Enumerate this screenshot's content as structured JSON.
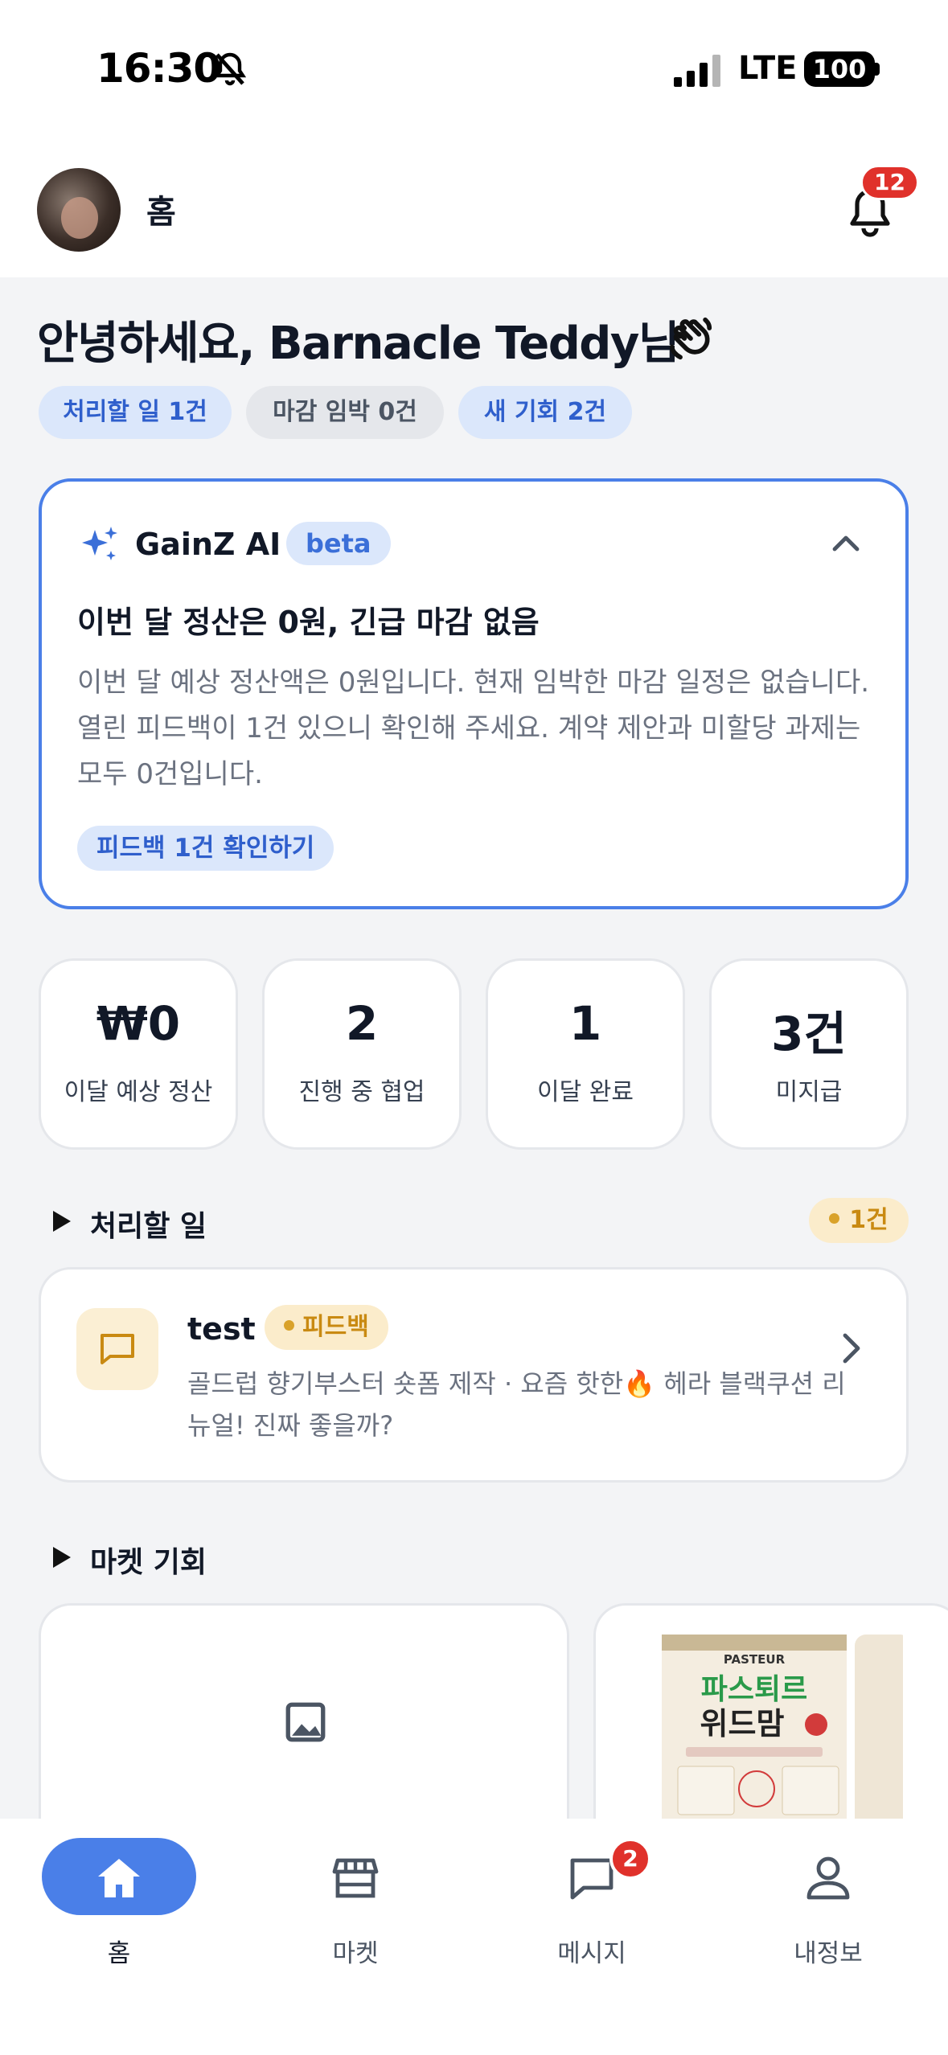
{
  "status_bar": {
    "time": "16:30",
    "network": "LTE",
    "battery": "100"
  },
  "header": {
    "title": "홈",
    "notification_count": "12"
  },
  "greeting": {
    "text": "안녕하세요, Barnacle Teddy님"
  },
  "chips": [
    {
      "label": "처리할 일 1건"
    },
    {
      "label": "마감 임박 0건"
    },
    {
      "label": "새 기회 2건"
    }
  ],
  "ai_card": {
    "title": "GainZ AI",
    "badge": "beta",
    "headline": "이번 달 정산은 0원, 긴급 마감 없음",
    "body": "이번 달 예상 정산액은 0원입니다. 현재 임박한 마감 일정은 없습니다. 열린 피드백이 1건 있으니 확인해 주세요. 계약 제안과 미할당 과제는 모두 0건입니다.",
    "action": "피드백 1건 확인하기"
  },
  "stats": [
    {
      "value": "₩0",
      "label": "이달 예상 정산"
    },
    {
      "value": "2",
      "label": "진행 중 협업"
    },
    {
      "value": "1",
      "label": "이달 완료"
    },
    {
      "value": "3건",
      "label": "미지급"
    }
  ],
  "todo_section": {
    "title": "처리할 일",
    "count": "1건"
  },
  "task": {
    "title": "test",
    "tag": "피드백",
    "description": "골드럽 향기부스터 숏폼 제작 · 요즘 핫한🔥 헤라 블랙쿠션 리뉴얼! 진짜 좋을까?"
  },
  "market_section": {
    "title": "마켓 기회"
  },
  "product": {
    "brand": "PASTEUR",
    "name_line1": "파스퇴르",
    "name_line2": "위드맘"
  },
  "tab_bar": {
    "tabs": [
      {
        "label": "홈"
      },
      {
        "label": "마켓"
      },
      {
        "label": "메시지",
        "badge": "2"
      },
      {
        "label": "내정보"
      }
    ]
  },
  "colors": {
    "accent": "#4a7fe8",
    "badge_red": "#e0312b",
    "amber": "#c98a12"
  }
}
